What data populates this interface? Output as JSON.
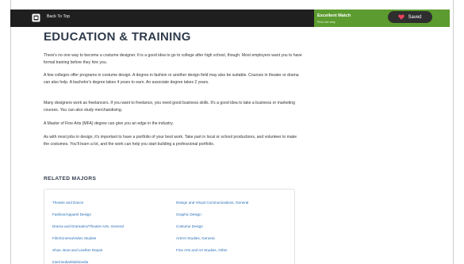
{
  "topbar": {
    "back_label": "Back To Top",
    "match_title": "Excellent Match",
    "match_subtitle": "Find out why",
    "saved_label": "Saved"
  },
  "colors": {
    "topbar_bg": "#1f1f1f",
    "match_bg": "#5c9b2f",
    "heart": "#e8425e",
    "link": "#2a6fb5",
    "heading": "#2f3b4c"
  },
  "icons": {
    "back": "back-to-top-icon",
    "saved": "heart-icon"
  },
  "main": {
    "title": "EDUCATION & TRAINING",
    "paragraphs": [
      "There's no one way to become a costume designer. It is a good idea to go to college after high school, though. Most employers want you to have formal training before they hire you.",
      "A few colleges offer programs in costume design. A degree in fashion or another design field may also be suitable. Courses in theater or drama can also help. A bachelor's degree takes 4 years to earn. An associate degree takes 2 years.",
      "Many designers work as freelancers. If you want to freelance, you need good business skills. It's a good idea to take a business or marketing courses. You can also study merchandising.",
      "A Master of Fine Arts (MFA) degree can give you an edge in the industry.",
      "As with most jobs in design, it's important to have a portfolio of your best work. Take part in local or school productions, and volunteer to make the costumes. You'll learn a lot, and the work can help you start building a professional portfolio."
    ],
    "related_title": "RELATED MAJORS",
    "related_majors": [
      "Theatre and Dance",
      "Design and Visual Communications, General",
      "Fashion/Apparel Design",
      "Graphic Design",
      "Drama and Dramatics/Theatre Arts, General",
      "Costume Design",
      "Film/Cinema/Video Studies",
      "Art/Art Studies, General",
      "Shoe, Boot and Leather Repair",
      "Fine Arts and Art Studies, Other",
      "Intermedia/Multimedia"
    ]
  }
}
